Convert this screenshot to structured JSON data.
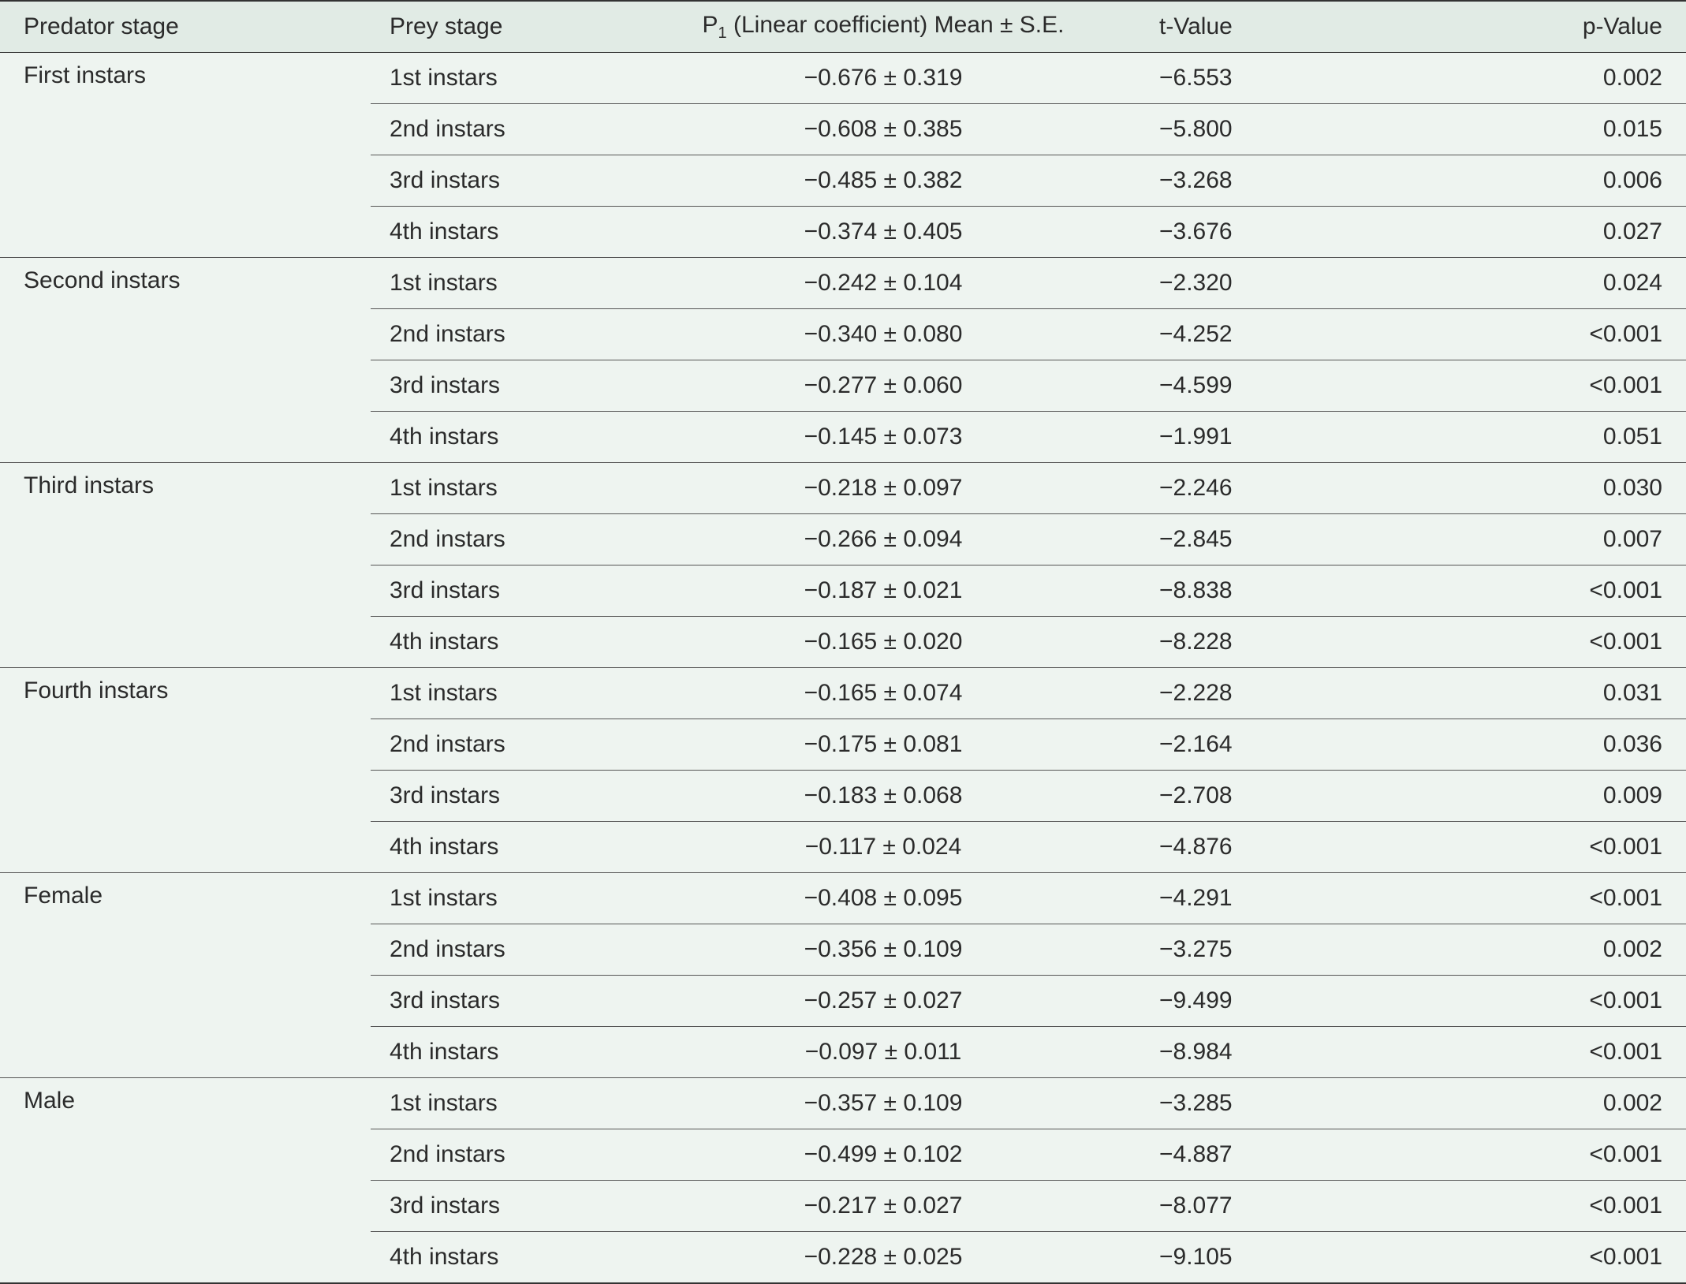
{
  "table": {
    "headers": {
      "predator_stage": "Predator stage",
      "prey_stage": "Prey stage",
      "coef_prefix": "P",
      "coef_subscript": "1",
      "coef_suffix": " (Linear coefficient) Mean ± S.E.",
      "t_value": "t-Value",
      "p_value": "p-Value"
    },
    "groups": [
      {
        "predator": "First instars",
        "rows": [
          {
            "prey": "1st instars",
            "coef": "−0.676 ± 0.319",
            "t": "−6.553",
            "p": "0.002"
          },
          {
            "prey": "2nd instars",
            "coef": "−0.608 ± 0.385",
            "t": "−5.800",
            "p": "0.015"
          },
          {
            "prey": "3rd instars",
            "coef": "−0.485 ± 0.382",
            "t": "−3.268",
            "p": "0.006"
          },
          {
            "prey": "4th instars",
            "coef": "−0.374 ± 0.405",
            "t": "−3.676",
            "p": "0.027"
          }
        ]
      },
      {
        "predator": "Second instars",
        "rows": [
          {
            "prey": "1st instars",
            "coef": "−0.242 ± 0.104",
            "t": "−2.320",
            "p": "0.024"
          },
          {
            "prey": "2nd instars",
            "coef": "−0.340 ± 0.080",
            "t": "−4.252",
            "p": "<0.001"
          },
          {
            "prey": "3rd instars",
            "coef": "−0.277 ± 0.060",
            "t": "−4.599",
            "p": "<0.001"
          },
          {
            "prey": "4th instars",
            "coef": "−0.145 ± 0.073",
            "t": "−1.991",
            "p": "0.051"
          }
        ]
      },
      {
        "predator": "Third instars",
        "rows": [
          {
            "prey": "1st instars",
            "coef": "−0.218 ± 0.097",
            "t": "−2.246",
            "p": "0.030"
          },
          {
            "prey": "2nd instars",
            "coef": "−0.266 ± 0.094",
            "t": "−2.845",
            "p": "0.007"
          },
          {
            "prey": "3rd instars",
            "coef": "−0.187 ± 0.021",
            "t": "−8.838",
            "p": "<0.001"
          },
          {
            "prey": "4th instars",
            "coef": "−0.165 ± 0.020",
            "t": "−8.228",
            "p": "<0.001"
          }
        ]
      },
      {
        "predator": "Fourth instars",
        "rows": [
          {
            "prey": "1st instars",
            "coef": "−0.165 ± 0.074",
            "t": "−2.228",
            "p": "0.031"
          },
          {
            "prey": "2nd instars",
            "coef": "−0.175 ± 0.081",
            "t": "−2.164",
            "p": "0.036"
          },
          {
            "prey": "3rd instars",
            "coef": "−0.183 ± 0.068",
            "t": "−2.708",
            "p": "0.009"
          },
          {
            "prey": "4th instars",
            "coef": "−0.117 ± 0.024",
            "t": "−4.876",
            "p": "<0.001"
          }
        ]
      },
      {
        "predator": "Female",
        "rows": [
          {
            "prey": "1st instars",
            "coef": "−0.408 ± 0.095",
            "t": "−4.291",
            "p": "<0.001"
          },
          {
            "prey": "2nd instars",
            "coef": "−0.356 ± 0.109",
            "t": "−3.275",
            "p": "0.002"
          },
          {
            "prey": "3rd instars",
            "coef": "−0.257 ± 0.027",
            "t": "−9.499",
            "p": "<0.001"
          },
          {
            "prey": "4th instars",
            "coef": "−0.097 ± 0.011",
            "t": "−8.984",
            "p": "<0.001"
          }
        ]
      },
      {
        "predator": "Male",
        "rows": [
          {
            "prey": "1st instars",
            "coef": "−0.357 ± 0.109",
            "t": "−3.285",
            "p": "0.002"
          },
          {
            "prey": "2nd instars",
            "coef": "−0.499 ± 0.102",
            "t": "−4.887",
            "p": "<0.001"
          },
          {
            "prey": "3rd instars",
            "coef": "−0.217 ± 0.027",
            "t": "−8.077",
            "p": "<0.001"
          },
          {
            "prey": "4th instars",
            "coef": "−0.228 ± 0.025",
            "t": "−9.105",
            "p": "<0.001"
          }
        ]
      }
    ]
  }
}
